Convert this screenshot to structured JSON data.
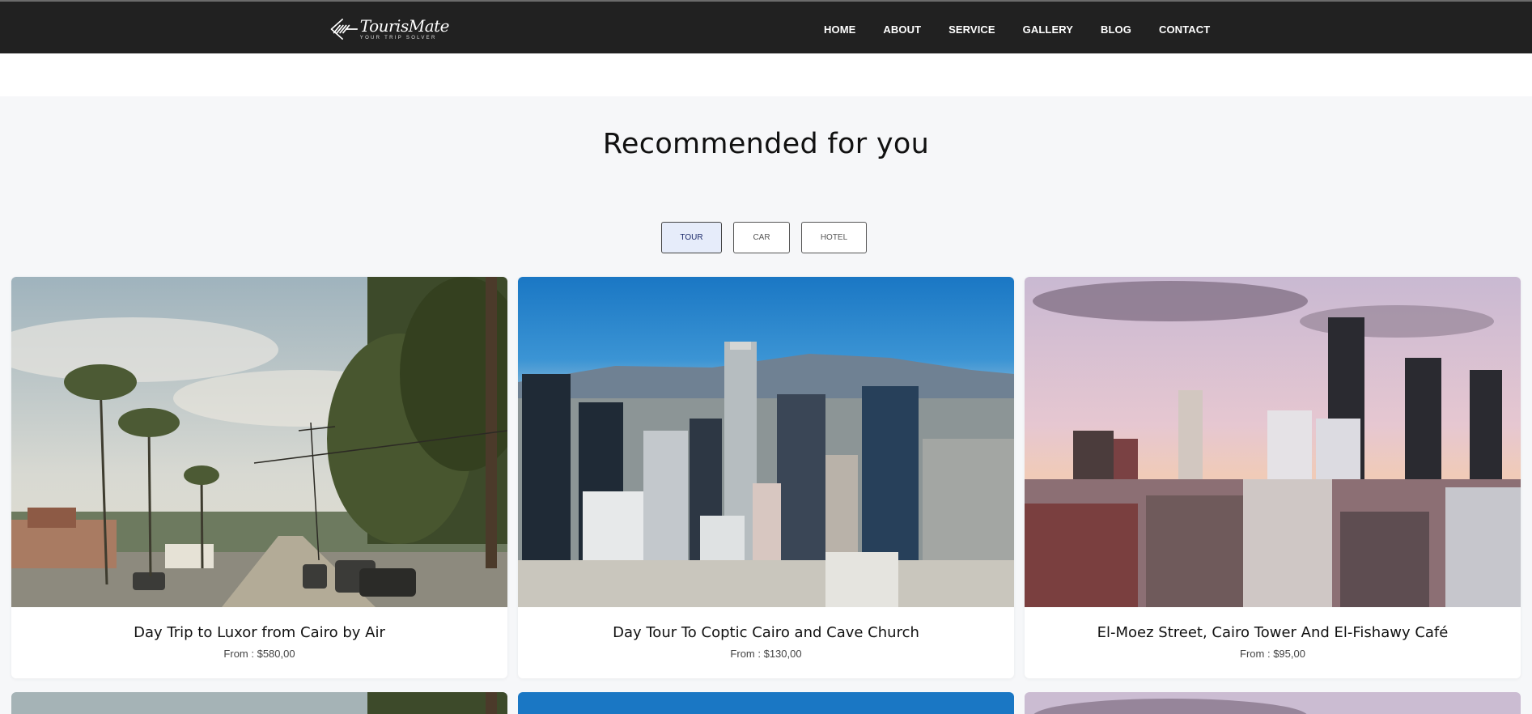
{
  "header": {
    "logo_name": "TourisMate",
    "logo_tagline": "YOUR TRIP SOLVER",
    "nav": [
      "HOME",
      "ABOUT",
      "SERVICE",
      "GALLERY",
      "BLOG",
      "CONTACT"
    ]
  },
  "section": {
    "title": "Recommended for you",
    "filters": [
      "TOUR",
      "CAR",
      "HOTEL"
    ],
    "active_filter": "TOUR"
  },
  "cards": [
    {
      "title": "Day Trip to Luxor from Cairo by Air",
      "price": "From : $580,00",
      "image": "palm-street-photo"
    },
    {
      "title": "Day Tour To Coptic Cairo and Cave Church",
      "price": "From : $130,00",
      "image": "downtown-skyline-photo"
    },
    {
      "title": "El-Moez Street, Cairo Tower And El-Fishawy Café",
      "price": "From : $95,00",
      "image": "dusk-skyline-photo"
    }
  ],
  "colors": {
    "header_bg": "#212121",
    "page_bg": "#f6f7f9",
    "active_filter_bg": "#e6ecfa"
  }
}
